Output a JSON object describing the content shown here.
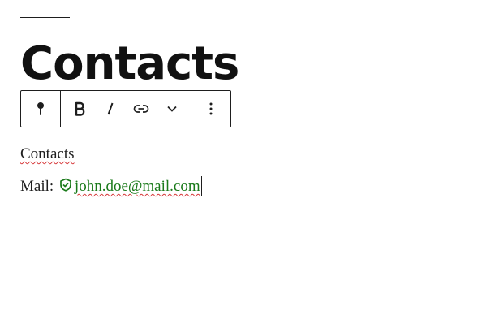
{
  "heading": {
    "text": "Contacts"
  },
  "toolbar": {
    "groups": [
      {
        "items": [
          {
            "icon": "pin-icon",
            "label": ""
          }
        ]
      },
      {
        "items": [
          {
            "icon": "bold-icon",
            "label": "B"
          },
          {
            "icon": "italic-icon",
            "label": "I"
          },
          {
            "icon": "link-icon",
            "label": ""
          },
          {
            "icon": "chevron-down-icon",
            "label": ""
          }
        ]
      },
      {
        "items": [
          {
            "icon": "more-options-icon",
            "label": ""
          }
        ]
      }
    ]
  },
  "content": {
    "paragraph1": "Contacts",
    "mail_label": "Mail:",
    "email_icon": "shield-check-icon",
    "email": "john.doe@mail.com"
  },
  "colors": {
    "text": "#1e1e1e",
    "email_link": "#1a7a1a",
    "spellcheck_underline": "#d63638"
  }
}
